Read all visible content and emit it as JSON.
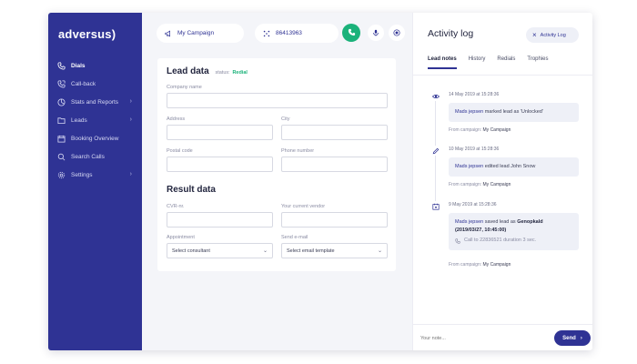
{
  "sidebar": {
    "logo": "adversus)",
    "items": [
      {
        "label": "Dials",
        "icon": "phone-icon",
        "active": true
      },
      {
        "label": "Call-back",
        "icon": "phone-callback-icon"
      },
      {
        "label": "Stats and Reports",
        "icon": "chart-pie-icon",
        "chevron": "›"
      },
      {
        "label": "Leads",
        "icon": "folder-icon",
        "chevron": "›"
      },
      {
        "label": "Booking Overview",
        "icon": "calendar-icon"
      },
      {
        "label": "Search Calls",
        "icon": "search-icon"
      },
      {
        "label": "Settings",
        "icon": "gear-icon",
        "chevron": "›"
      }
    ]
  },
  "topbar": {
    "campaign": "My Campaign",
    "phone": "86413963"
  },
  "lead": {
    "title": "Lead data",
    "status_label": "status:",
    "status_value": "Redial",
    "fields": {
      "company": "Company name",
      "address": "Address",
      "city": "City",
      "postal": "Postal code",
      "phone": "Phone number"
    }
  },
  "result": {
    "title": "Result data",
    "fields": {
      "cvr": "CVR-nr.",
      "vendor": "Your current vendor",
      "appointment": "Appointment",
      "send_email": "Send e-mail"
    },
    "selects": {
      "consultant": "Select consultant",
      "email_template": "Select email template"
    }
  },
  "activity": {
    "title": "Activity log",
    "chip_label": "Activity Log",
    "tabs": [
      "Lead notes",
      "History",
      "Redials",
      "Trophies"
    ],
    "entries": [
      {
        "time": "14 May 2019 at 15:28:36",
        "icon": "eye-icon",
        "who": "Mads jepsen",
        "action": "marked lead as 'Unlocked'",
        "from_label": "From campaign:",
        "campaign": "My Campaign"
      },
      {
        "time": "10 May 2019 at 15:28:36",
        "icon": "edit-icon",
        "who": "Mads jepsen",
        "action": "edited lead",
        "target": "John Snow",
        "from_label": "From campaign:",
        "campaign": "My Campaign"
      },
      {
        "time": "9 May 2019 at 15:28:36",
        "icon": "calendar-check-icon",
        "who": "Mads jepsen",
        "action": "saved lead as",
        "target": "Genopkald",
        "detail": "(2019/03/27, 10:45:00)",
        "call": "Call to 22836521 duration 3 sec.",
        "from_label": "From campaign:",
        "campaign": "My Campaign"
      }
    ],
    "note_placeholder": "Your note...",
    "send_label": "Send",
    "send_chevron": "›"
  },
  "colors": {
    "sidebar": "#2f3394",
    "accent": "#2f3394",
    "success": "#1bb27a",
    "bubble": "#eef0f7"
  }
}
